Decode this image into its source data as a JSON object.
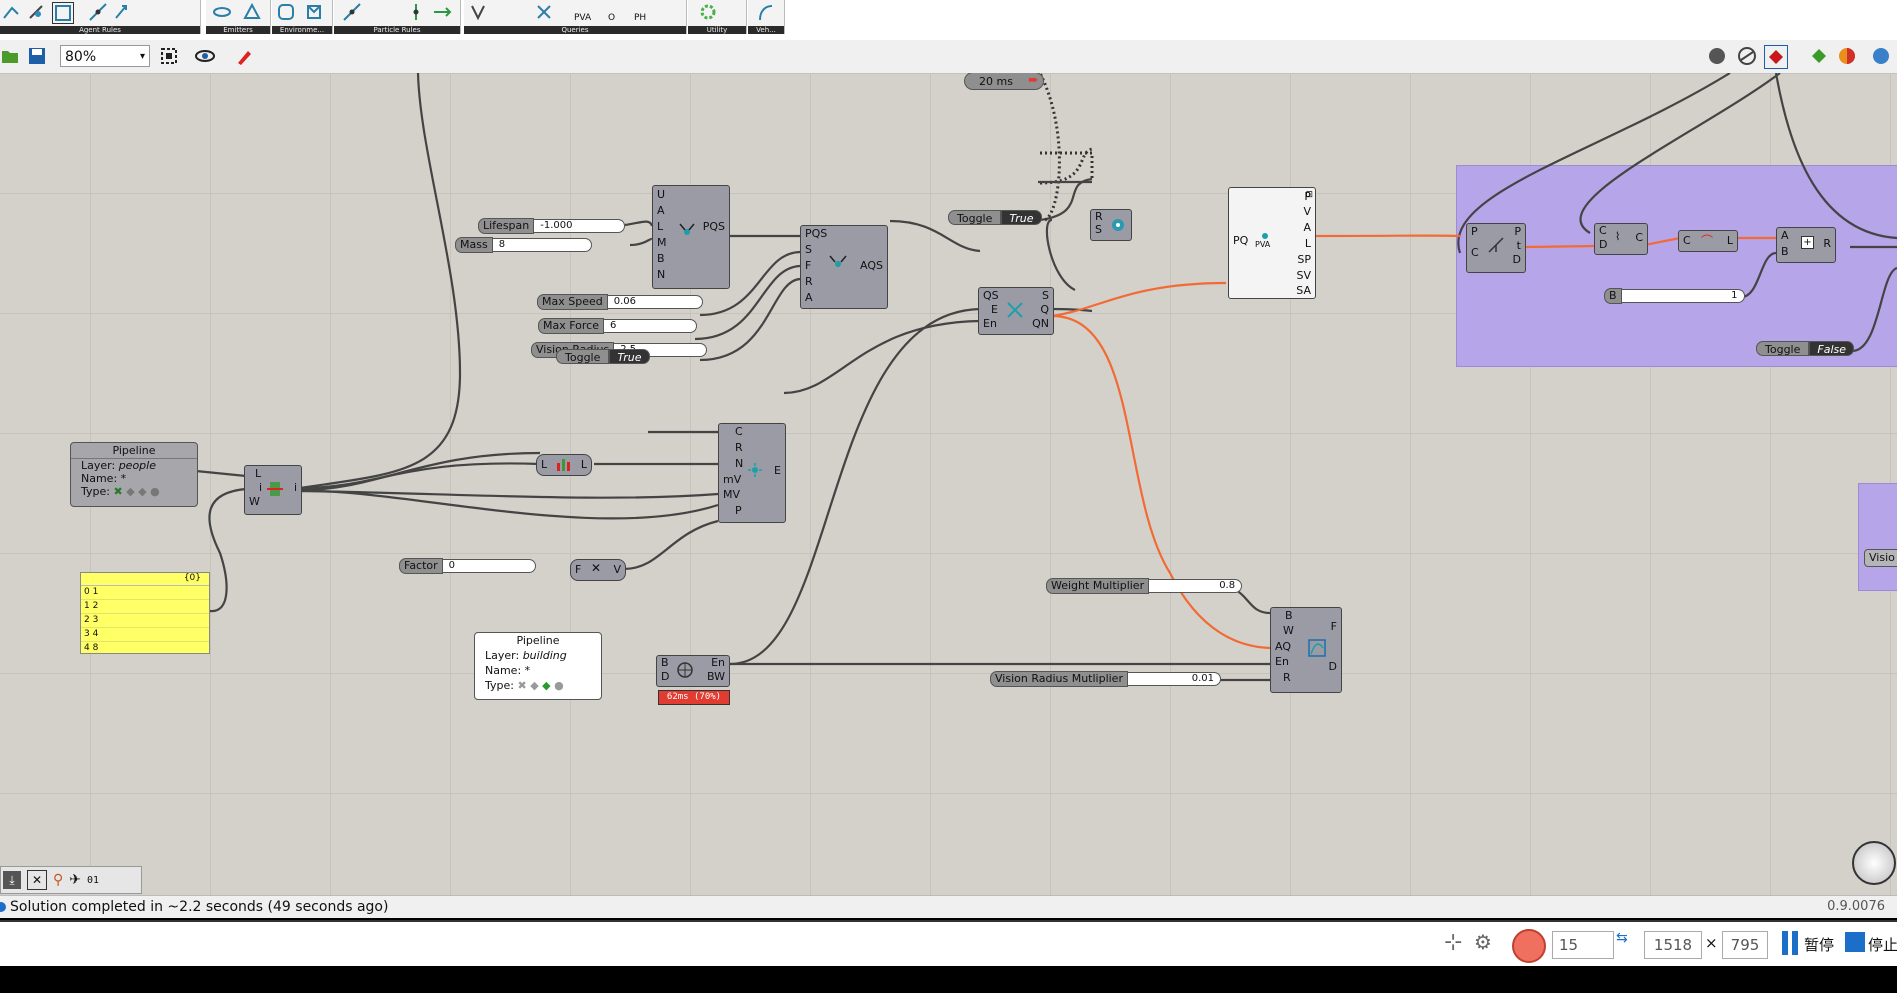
{
  "ribbon": {
    "groups": [
      {
        "caption": "Agent Rules"
      },
      {
        "caption": "Emitters"
      },
      {
        "caption": "Environme..."
      },
      {
        "caption": "Particle Rules"
      },
      {
        "caption": "Queries"
      },
      {
        "caption": "Utility"
      },
      {
        "caption": "Veh..."
      }
    ],
    "query_labels": [
      "PVA",
      "O",
      "PH"
    ]
  },
  "toolbar": {
    "zoom": "80%"
  },
  "canvas": {
    "timer": {
      "label": "20 ms"
    },
    "sliders": {
      "lifespan": {
        "label": "Lifespan",
        "value": "-1.000"
      },
      "mass": {
        "label": "Mass",
        "value": "8"
      },
      "max_speed": {
        "label": "Max Speed",
        "value": "0.06"
      },
      "max_force": {
        "label": "Max Force",
        "value": "6"
      },
      "vision_radius": {
        "label": "Vision Radius",
        "value": "2.5"
      },
      "factor": {
        "label": "Factor",
        "value": "0"
      },
      "weight_multiplier": {
        "label": "Weight Multiplier",
        "value": "0.8"
      },
      "vision_radius_multiplier": {
        "label": "Vision Radius Mutliplier",
        "value": "0.01"
      },
      "b": {
        "label": "B",
        "value": "1"
      }
    },
    "toggles": {
      "toggle_top": {
        "label": "Toggle",
        "value": "True"
      },
      "toggle_mid": {
        "label": "Toggle",
        "value": "True"
      },
      "toggle_right": {
        "label": "Toggle",
        "value": "False"
      }
    },
    "pipelines": {
      "people": {
        "title": "Pipeline",
        "layer_key": "Layer:",
        "layer": "people",
        "name_key": "Name:",
        "name": "*",
        "type_key": "Type:"
      },
      "building": {
        "title": "Pipeline",
        "layer_key": "Layer:",
        "layer": "building",
        "name_key": "Name:",
        "name": "*",
        "type_key": "Type:"
      }
    },
    "panel": {
      "header": "{0}",
      "rows": [
        "0 1",
        "1 2",
        "2 3",
        "3 4",
        "4 8"
      ]
    },
    "components": {
      "particle": {
        "inputs": [
          "U",
          "A",
          "L",
          "M",
          "B",
          "N"
        ],
        "outputs": [
          "PQS"
        ]
      },
      "agent": {
        "inputs": [
          "PQS",
          "S",
          "F",
          "R",
          "A"
        ],
        "outputs": [
          "AQS"
        ]
      },
      "engine": {
        "inputs": [
          "QS",
          "E",
          "En"
        ],
        "outputs": [
          "S",
          "Q",
          "QN"
        ]
      },
      "reset": {
        "inputs": [
          "R",
          "S"
        ]
      },
      "query": {
        "inputs": [
          "PQ"
        ],
        "outputs": [
          "P",
          "V",
          "A",
          "L",
          "SP",
          "SV",
          "SA"
        ],
        "sublabel": "PVA"
      },
      "environment": {
        "inputs": [
          "C",
          "R",
          "N",
          "mV",
          "MV",
          "P"
        ],
        "outputs": [
          "E"
        ]
      },
      "listitem": {
        "inputs": [
          "L",
          "i",
          "W"
        ],
        "outputs": [
          "i"
        ]
      },
      "line": {
        "inputs": [
          "L"
        ],
        "outputs": [
          "L"
        ]
      },
      "vector": {
        "inputs": [
          "F"
        ],
        "outputs": [
          "V"
        ]
      },
      "brep": {
        "inputs": [
          "B",
          "D"
        ],
        "outputs": [
          "En",
          "BW"
        ],
        "timing": "62ms (70%)"
      },
      "behavior": {
        "inputs": [
          "B",
          "W",
          "AQ",
          "En",
          "R"
        ],
        "outputs": [
          "F",
          "D"
        ]
      },
      "evaluate": {
        "inputs": [
          "P",
          "C"
        ],
        "outputs": [
          "P",
          "t",
          "D"
        ]
      },
      "curve1": {
        "inputs": [
          "C",
          "D"
        ],
        "outputs": [
          "C"
        ]
      },
      "curve2": {
        "inputs": [
          "C"
        ],
        "outputs": [
          "L"
        ]
      },
      "add": {
        "inputs": [
          "A",
          "B"
        ],
        "outputs": [
          "R"
        ]
      },
      "vision_partial": {
        "label": "Visio"
      }
    }
  },
  "status": {
    "message": "Solution completed in ~2.2 seconds (49 seconds ago)",
    "version": "0.9.0076"
  },
  "taskbar": {
    "count": "15",
    "width": "1518",
    "times": "×",
    "height": "795",
    "pause": "暂停",
    "stop": "停止"
  },
  "colors": {
    "canvas": "#d4d1cb",
    "group": "#b7a5ea",
    "wire_selected": "#f26a35",
    "panel": "#ffff66",
    "timing": "#e03c31"
  }
}
